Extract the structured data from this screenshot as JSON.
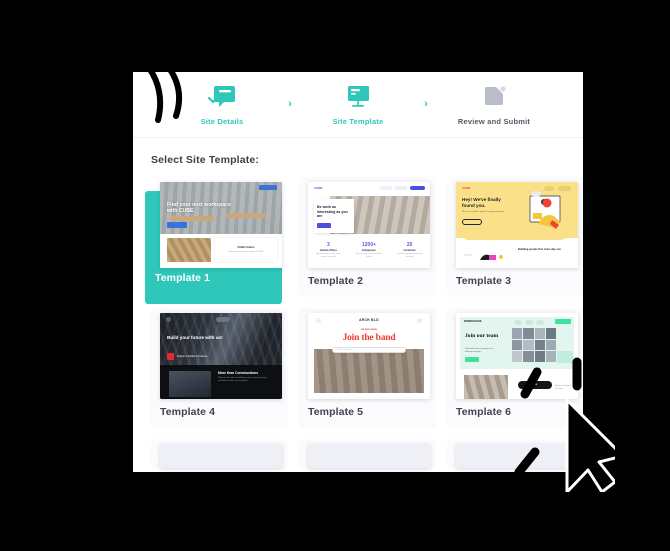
{
  "stepper": {
    "steps": [
      {
        "label": "Site Details",
        "icon": "chat-check-icon",
        "state": "active"
      },
      {
        "label": "Site Template",
        "icon": "monitor-icon",
        "state": "active"
      },
      {
        "label": "Review and Submit",
        "icon": "folder-icon",
        "state": "inactive"
      }
    ],
    "separator": "›"
  },
  "main": {
    "section_title": "Select Site Template:",
    "selected_template": "Template 1",
    "templates": [
      {
        "label": "Template 1",
        "selected": true,
        "preview": {
          "headline": "Find your next workspace with CUBE",
          "nav_button": "",
          "cta": "",
          "section_title": "CUBE Culture",
          "section_sub": "Discover what it is like to work at CUBE"
        }
      },
      {
        "label": "Template 2",
        "selected": false,
        "preview": {
          "logo": "CUBE",
          "headline": "Be work as interesting as you are",
          "cta": "Learn more",
          "stats": [
            {
              "value": "3",
              "title": "Global offices",
              "sub": "We are hiring in many cities across the world"
            },
            {
              "value": "1200+",
              "title": "Employees",
              "sub": "Best in class team around the globe"
            },
            {
              "value": "20",
              "title": "Countries",
              "sub": "Creating opportunity in many countries"
            }
          ]
        }
      },
      {
        "label": "Template 3",
        "selected": false,
        "preview": {
          "logo": "CUBE",
          "headline": "Hey! We've finally found you.",
          "sub": "We are in creative, great & hungry to get here!",
          "cta": "Get started",
          "footer_headline": "Building people first since day one"
        }
      },
      {
        "label": "Template 4",
        "selected": false,
        "preview": {
          "headline": "Build your future with us!",
          "badge": "Explore Flexible & Curious",
          "section_title": "More than Constructions",
          "section_sub": "Whatever the agency building is, we are here to design and build the place you imagined."
        }
      },
      {
        "label": "Template 5",
        "selected": false,
        "preview": {
          "logo": "ARCH BLD",
          "kicker": "WE ARE HIRING",
          "headline": "Join the band",
          "search_placeholder": "Search your role"
        }
      },
      {
        "label": "Template 6",
        "selected": false,
        "preview": {
          "logo": "WORKHOUSE",
          "nav": [
            "About",
            "Work",
            "Team"
          ],
          "nav_button": "Contact",
          "headline": "Join our team",
          "sub": "Work with the best people in the industry and grow",
          "cta": "Join now",
          "pill": "About us"
        }
      }
    ]
  },
  "colors": {
    "accent_teal": "#2ec7ba",
    "panel_bg": "#ffffff",
    "card_bg": "#fbfbfd",
    "text_dark": "#3f4451",
    "backdrop": "#000000"
  },
  "cursor": {
    "icon": "click-cursor-icon"
  }
}
